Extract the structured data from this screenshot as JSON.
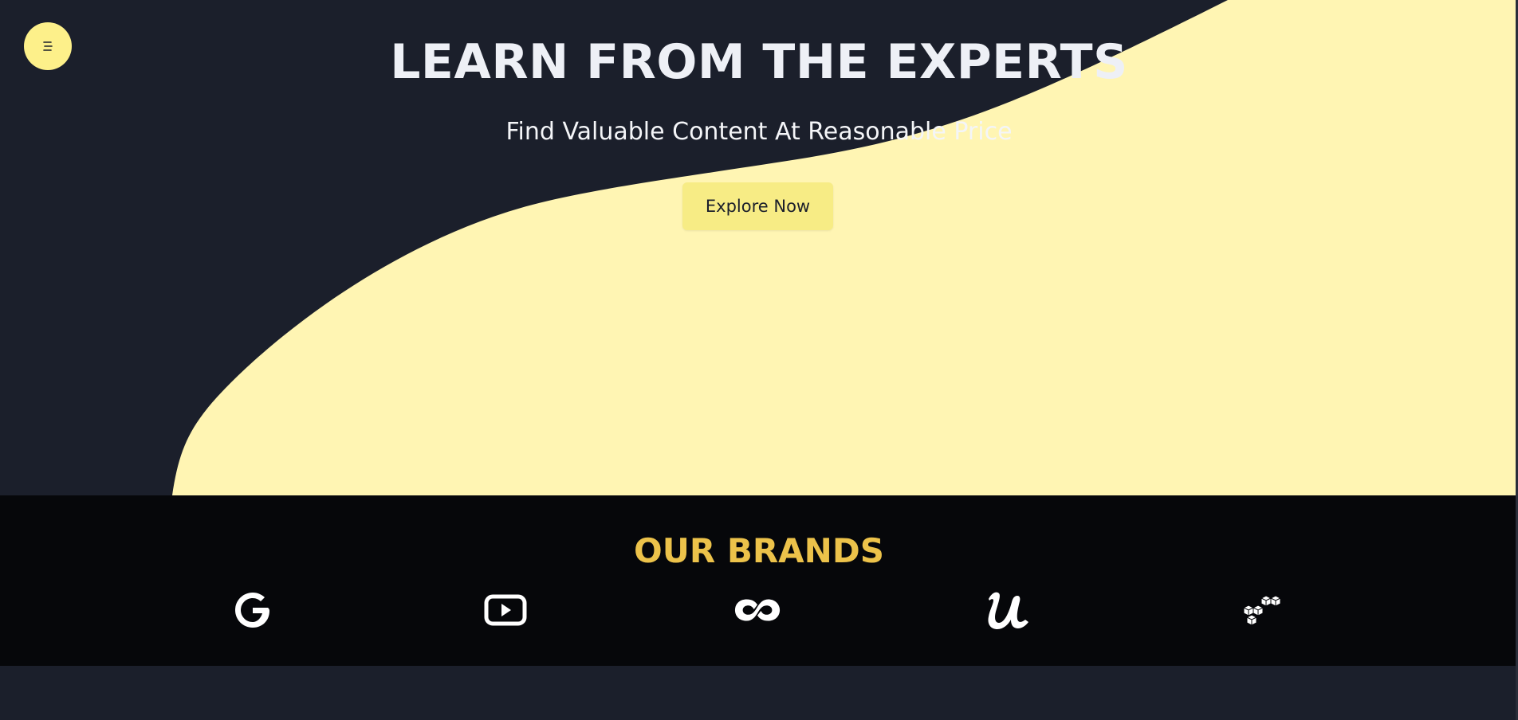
{
  "hero": {
    "title": "LEARN FROM THE EXPERTS",
    "subtitle": "Find Valuable Content At Reasonable Price",
    "cta_label": "Explore Now"
  },
  "menu": {
    "icon": "menu-lines-icon"
  },
  "brands": {
    "title": "OUR BRANDS",
    "logos": [
      {
        "name": "google-icon"
      },
      {
        "name": "youtube-icon"
      },
      {
        "name": "coursera-icon"
      },
      {
        "name": "udemy-icon"
      },
      {
        "name": "cubes-icon"
      }
    ]
  },
  "colors": {
    "background": "#1b1f2b",
    "accent": "#fdf08a",
    "brand_title": "#ecc24a",
    "brands_band": "#06070a"
  }
}
